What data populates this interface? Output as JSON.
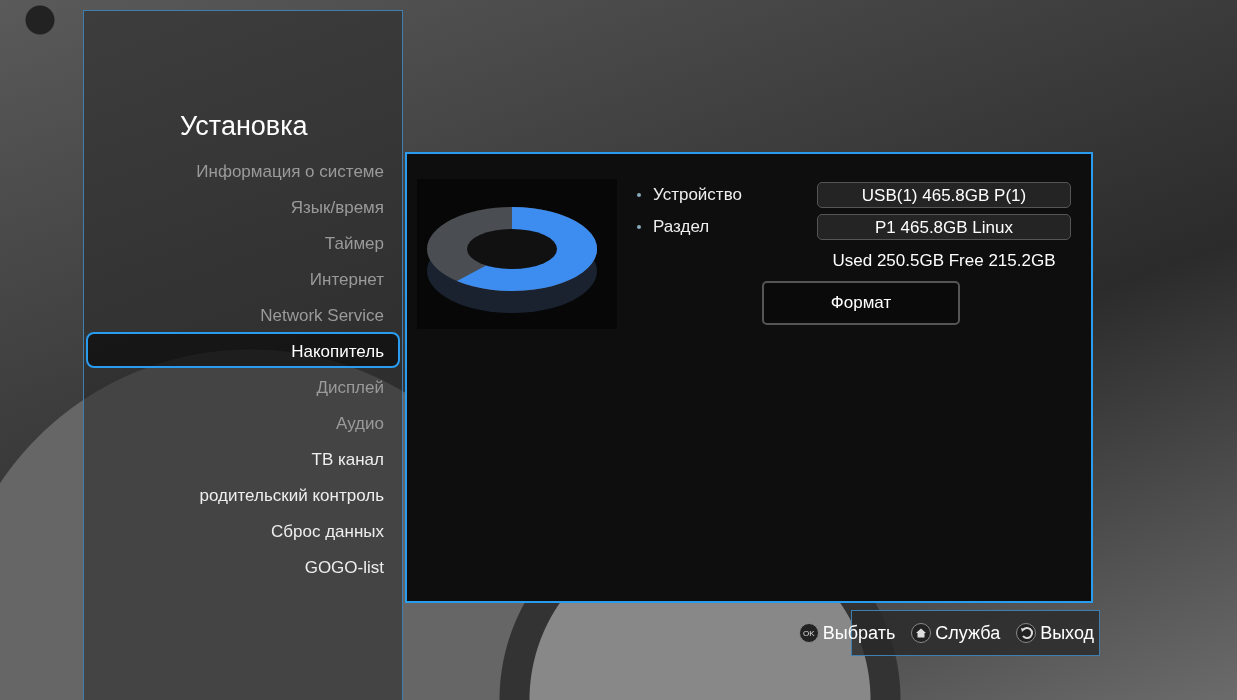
{
  "sidebar": {
    "title": "Установка",
    "items": [
      {
        "label": "Информация о системе",
        "selected": false,
        "dimmed": true
      },
      {
        "label": "Язык/время",
        "selected": false,
        "dimmed": true
      },
      {
        "label": "Таймер",
        "selected": false,
        "dimmed": true
      },
      {
        "label": "Интернет",
        "selected": false,
        "dimmed": true
      },
      {
        "label": "Network Service",
        "selected": false,
        "dimmed": true
      },
      {
        "label": "Накопитель",
        "selected": true,
        "dimmed": false
      },
      {
        "label": "Дисплей",
        "selected": false,
        "dimmed": true
      },
      {
        "label": "Аудио",
        "selected": false,
        "dimmed": true
      },
      {
        "label": "ТВ канал",
        "selected": false,
        "dimmed": false
      },
      {
        "label": "родительский контроль",
        "selected": false,
        "dimmed": false
      },
      {
        "label": "Сброс данных",
        "selected": false,
        "dimmed": false
      },
      {
        "label": "GOGO-list",
        "selected": false,
        "dimmed": false
      }
    ]
  },
  "storage": {
    "fields": [
      {
        "label": "Устройство",
        "value": "USB(1) 465.8GB P(1)"
      },
      {
        "label": "Раздел",
        "value": "P1 465.8GB Linux"
      }
    ],
    "usage": "Used 250.5GB Free 215.2GB",
    "button": "Формат"
  },
  "footer": [
    {
      "kind": "ok",
      "key": "OK",
      "label": "Выбрать"
    },
    {
      "kind": "home",
      "label": "Служба"
    },
    {
      "kind": "back",
      "label": "Выход"
    }
  ]
}
